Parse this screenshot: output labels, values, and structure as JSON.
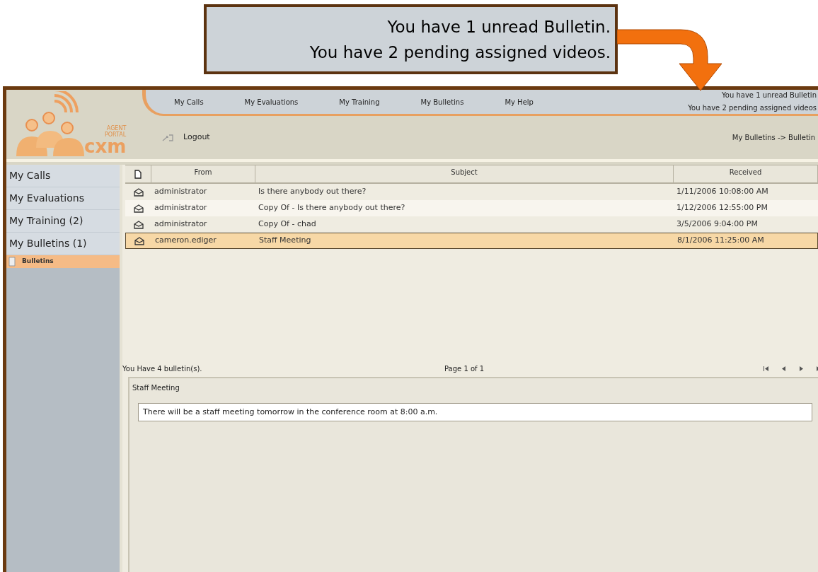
{
  "callout": {
    "lines": [
      "You have 1 unread Bulletin.",
      "You have 2 pending assigned videos."
    ]
  },
  "logo": {
    "tagline_1": "AGENT",
    "tagline_2": "PORTAL",
    "brand": "cxm"
  },
  "nav": {
    "items": [
      {
        "label": "My Calls"
      },
      {
        "label": "My Evaluations"
      },
      {
        "label": "My Training"
      },
      {
        "label": "My Bulletins"
      },
      {
        "label": "My Help"
      }
    ]
  },
  "notices": [
    "You have 1 unread Bulletin",
    "You have 2 pending assigned videos"
  ],
  "logout": "Logout",
  "breadcrumb": "My Bulletins -> Bulletin",
  "sidebar": {
    "items": [
      {
        "label": "My Calls"
      },
      {
        "label": "My Evaluations"
      },
      {
        "label": "My Training (2)"
      },
      {
        "label": "My Bulletins (1)",
        "children": [
          {
            "label": "Bulletins",
            "selected": true
          }
        ]
      }
    ]
  },
  "table": {
    "columns": [
      "From",
      "Subject",
      "Received"
    ],
    "rows": [
      {
        "from": "administrator",
        "subject": "Is there anybody out there?",
        "received": "1/11/2006 10:08:00 AM",
        "selected": false
      },
      {
        "from": "administrator",
        "subject": "Copy Of - Is there anybody out there?",
        "received": "1/12/2006 12:55:00 PM",
        "selected": false
      },
      {
        "from": "administrator",
        "subject": "Copy Of - chad",
        "received": "3/5/2006 9:04:00 PM",
        "selected": false
      },
      {
        "from": "cameron.ediger",
        "subject": "Staff Meeting",
        "received": "8/1/2006 11:25:00 AM",
        "selected": true
      }
    ]
  },
  "footer": {
    "count": "You Have 4 bulletin(s).",
    "page": "Page 1 of 1"
  },
  "detail": {
    "title": "Staff Meeting",
    "body": "There will be a staff meeting tomorrow in the conference room at 8:00 a.m."
  }
}
